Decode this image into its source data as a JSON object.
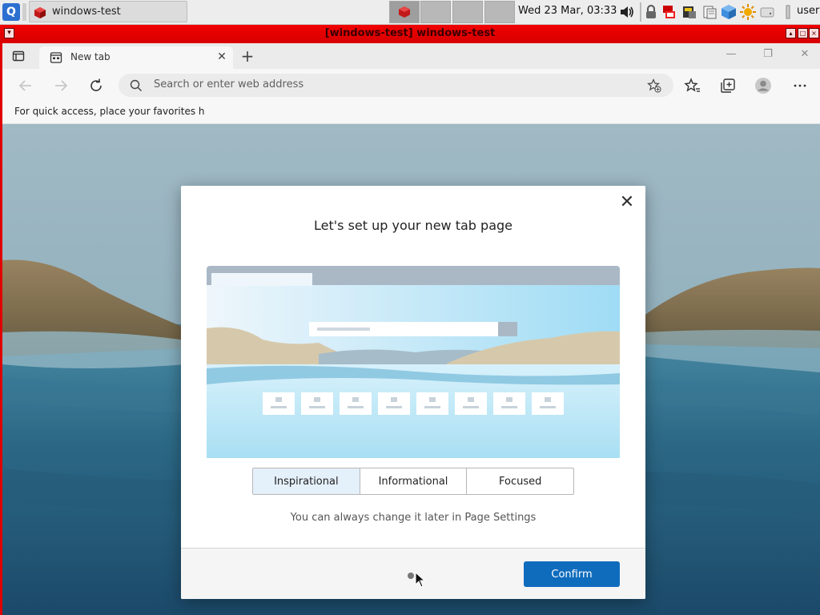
{
  "taskbar": {
    "start_icon": "qubes-menu-icon",
    "task_label": "windows-test",
    "clock": "Wed 23 Mar, 03:33",
    "user": "user",
    "tray_icons": [
      "volume-icon",
      "lock-icon",
      "network-icon",
      "clipboard-icon",
      "notes-icon",
      "cube-icon",
      "sun-icon",
      "disk-icon",
      "power-icon"
    ]
  },
  "window": {
    "title": "[windows-test] windows-test",
    "frame_color": "#e00000"
  },
  "browser": {
    "tab_label": "New tab",
    "address_placeholder": "Search or enter web address",
    "favorites_bar_text": "For quick access, place your favorites h"
  },
  "modal": {
    "title": "Let's set up your new tab page",
    "options": [
      "Inspirational",
      "Informational",
      "Focused"
    ],
    "selected_option": "Inspirational",
    "note": "You can always change it later in Page Settings",
    "confirm_label": "Confirm",
    "accent_color": "#0f6cbd"
  }
}
